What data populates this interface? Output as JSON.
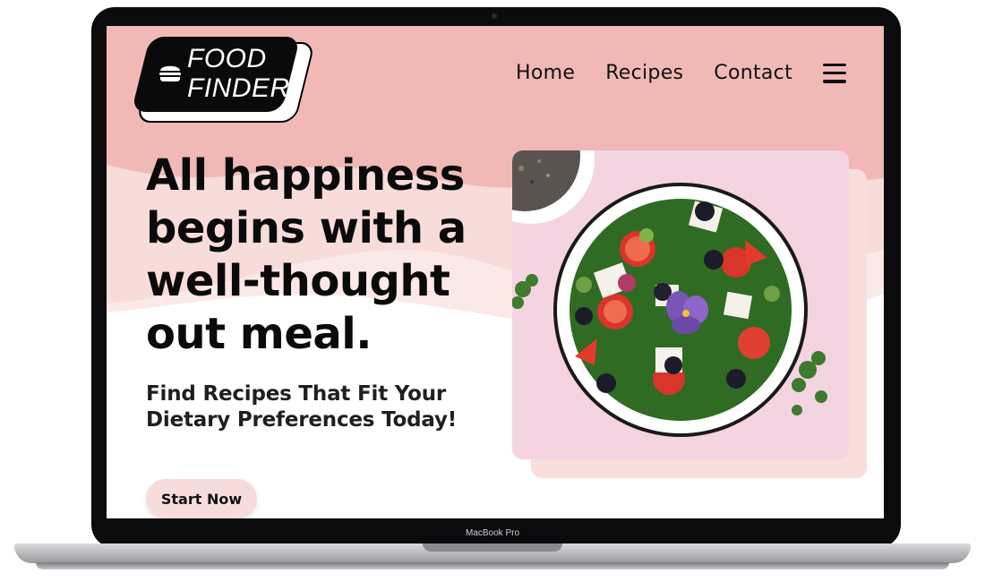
{
  "device": {
    "label": "MacBook Pro"
  },
  "logo": {
    "line1": "FOOD",
    "line2": "FINDER",
    "icon": "burger-icon"
  },
  "nav": {
    "items": [
      {
        "label": "Home"
      },
      {
        "label": "Recipes"
      },
      {
        "label": "Contact"
      }
    ],
    "menu_icon": "hamburger-menu-icon"
  },
  "hero": {
    "headline_lines": [
      "All happiness",
      "begins with a",
      "well-thought",
      "out meal."
    ],
    "subhead_lines": [
      "Find Recipes That Fit Your",
      "Dietary Preferences Today!"
    ],
    "cta_label": "Start Now"
  },
  "image": {
    "subject": "salad-bowl-photo"
  },
  "colors": {
    "header_pink": "#f0b9b6",
    "wave_light": "#f9e0dd",
    "cta_bg": "#f7dcdc",
    "card_bg": "#f4d4e0",
    "text_dark": "#0a0a0a"
  }
}
